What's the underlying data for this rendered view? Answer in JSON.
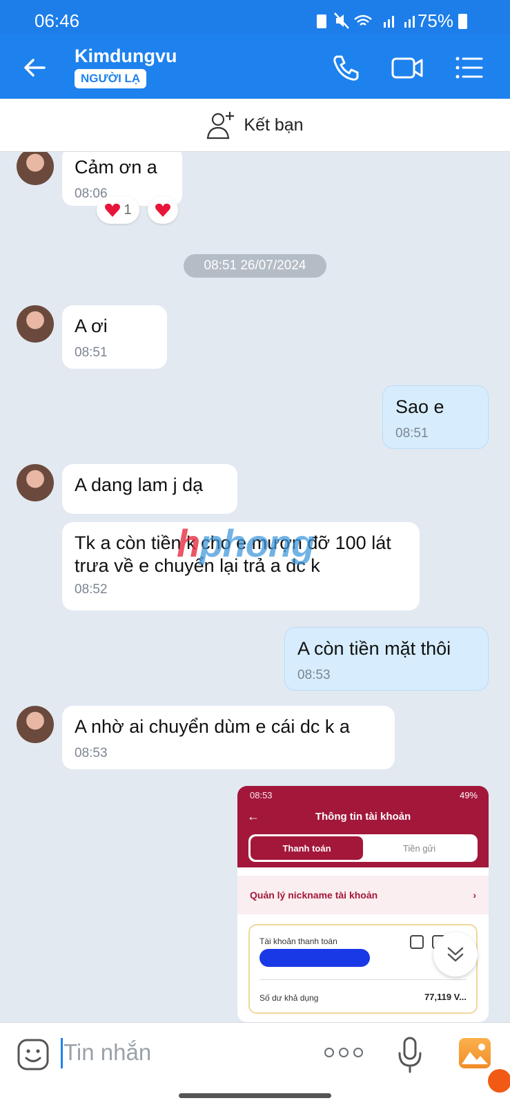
{
  "status_bar": {
    "time": "06:46",
    "battery": "75%"
  },
  "header": {
    "name": "Kimdungvu",
    "badge": "NGƯỜI LẠ"
  },
  "add_friend": {
    "label": "Kết bạn"
  },
  "messages": {
    "m1": {
      "text": "Cảm ơn a",
      "time": "08:06",
      "reaction_count": "1"
    },
    "date_divider": "08:51 26/07/2024",
    "m2": {
      "text": "A ơi",
      "time": "08:51"
    },
    "m3": {
      "text": "Sao e",
      "time": "08:51"
    },
    "m4": {
      "text": "A dang lam j dạ"
    },
    "m5": {
      "text": "Tk a còn tiền k cho e mượn đỡ 100 lát trưa về e chuyển lại trả a dc k",
      "time": "08:52"
    },
    "m6": {
      "text": "A còn tiền mặt thôi",
      "time": "08:53"
    },
    "m7": {
      "text": "A nhờ ai chuyển dùm e cái dc k a",
      "time": "08:53"
    }
  },
  "image_message": {
    "status_time": "08:53",
    "status_battery": "49%",
    "title": "Thông tin tài khoản",
    "tab_active": "Thanh toán",
    "tab_other": "Tiền gửi",
    "nickname_row": "Quản lý nickname tài khoản",
    "account_label": "Tài khoản thanh toán",
    "balance_label": "Số dư khả dụng",
    "balance_value": "77,119 V..."
  },
  "watermark": {
    "part1": "h",
    "part2": "phong"
  },
  "input": {
    "placeholder": "Tin nhắn"
  },
  "colors": {
    "header": "#1e82ee",
    "background": "#e2e9f1",
    "outgoing": "#d7edfd",
    "bank": "#a3173a"
  }
}
